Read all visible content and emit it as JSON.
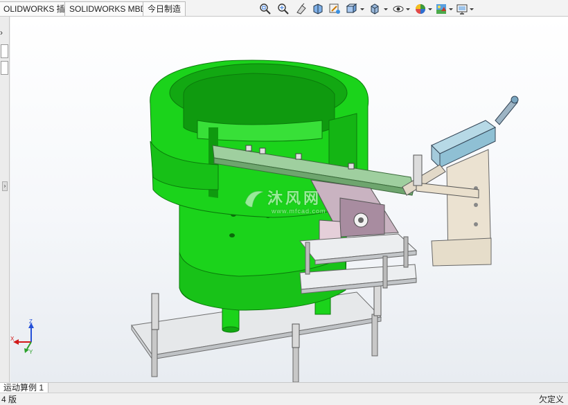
{
  "tabs": [
    {
      "label": "OLIDWORKS 插件"
    },
    {
      "label": "SOLIDWORKS MBD"
    },
    {
      "label": "今日制造"
    }
  ],
  "heads_up_toolbar": [
    {
      "icon": "zoom-to-fit-icon"
    },
    {
      "icon": "zoom-to-area-icon"
    },
    {
      "icon": "previous-view-icon"
    },
    {
      "icon": "section-view-icon"
    },
    {
      "icon": "dynamic-annotation-icon"
    },
    {
      "icon": "view-orientation-icon"
    },
    {
      "icon": "display-style-icon"
    },
    {
      "icon": "hide-show-items-icon"
    },
    {
      "icon": "edit-appearance-icon"
    },
    {
      "icon": "apply-scene-icon"
    },
    {
      "icon": "view-settings-icon"
    }
  ],
  "watermark": {
    "text": "沐风网",
    "url": "www.mfcad.com"
  },
  "triad": {
    "x": "X",
    "y": "Y",
    "z": "Z"
  },
  "bottom_tabs": [
    {
      "label": "运动算例 1"
    }
  ],
  "status": {
    "left": "4 版",
    "right": "欠定义"
  },
  "colors": {
    "bowl": "#1bd31b",
    "bowl_dark": "#0f9a0f",
    "plate": "#e6e8ea",
    "rail": "#9fcf9f",
    "axis_x": "#d11919",
    "axis_y": "#2aa12a",
    "axis_z": "#2450d8"
  }
}
